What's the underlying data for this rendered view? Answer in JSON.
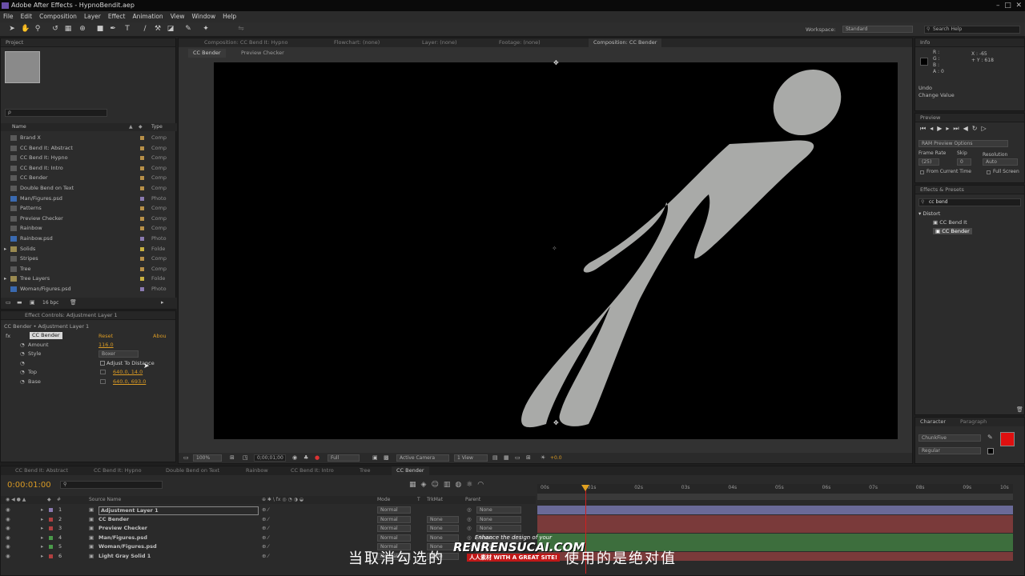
{
  "window": {
    "title": "Adobe After Effects - HypnoBendit.aep"
  },
  "menu": [
    "File",
    "Edit",
    "Composition",
    "Layer",
    "Effect",
    "Animation",
    "View",
    "Window",
    "Help"
  ],
  "toolbar": {
    "workspace_label": "Workspace:",
    "workspace_value": "Standard",
    "search_placeholder": "Search Help"
  },
  "project": {
    "tab": "Project",
    "search_placeholder": "ρ",
    "col_name": "Name",
    "col_type": "Type",
    "items": [
      {
        "name": "Brand X",
        "type": "Comp",
        "color": "#b89048"
      },
      {
        "name": "CC Bend It: Abstract",
        "type": "Comp",
        "color": "#b89048"
      },
      {
        "name": "CC Bend It: Hypno",
        "type": "Comp",
        "color": "#b89048"
      },
      {
        "name": "CC Bend It: Intro",
        "type": "Comp",
        "color": "#b89048"
      },
      {
        "name": "CC Bender",
        "type": "Comp",
        "color": "#b89048"
      },
      {
        "name": "Double Bend on Text",
        "type": "Comp",
        "color": "#b89048"
      },
      {
        "name": "Man/Figures.psd",
        "type": "Photo",
        "color": "#8a7ab0"
      },
      {
        "name": "Patterns",
        "type": "Comp",
        "color": "#b89048"
      },
      {
        "name": "Preview Checker",
        "type": "Comp",
        "color": "#b89048"
      },
      {
        "name": "Rainbow",
        "type": "Comp",
        "color": "#b89048"
      },
      {
        "name": "Rainbow.psd",
        "type": "Photo",
        "color": "#8a7ab0"
      },
      {
        "name": "Solids",
        "type": "Folde",
        "color": "#c8b040"
      },
      {
        "name": "Stripes",
        "type": "Comp",
        "color": "#b89048"
      },
      {
        "name": "Tree",
        "type": "Comp",
        "color": "#b89048"
      },
      {
        "name": "Tree Layers",
        "type": "Folde",
        "color": "#c8b040"
      },
      {
        "name": "Woman/Figures.psd",
        "type": "Photo",
        "color": "#8a7ab0"
      }
    ],
    "bpc": "16 bpc"
  },
  "effect_controls": {
    "tab": "Effect Controls: Adjustment Layer 1",
    "breadcrumb": "CC Bender • Adjustment Layer 1",
    "effect_name": "CC Bender",
    "reset": "Reset",
    "about": "Abou",
    "amount_label": "Amount",
    "amount_value": "116.0",
    "style_label": "Style",
    "style_value": "Boxer",
    "adjust_label": "Adjust To Distance",
    "top_label": "Top",
    "top_value": "640.0, 14.0",
    "base_label": "Base",
    "base_value": "640.0, 693.0"
  },
  "viewer_tabs": {
    "comp_tab_1": "Composition: CC Bend It: Hypno",
    "flowchart": "Flowchart: (none)",
    "layer": "Layer: (none)",
    "footage": "Footage: (none)",
    "comp_tab_active": "Composition: CC Bender",
    "sub_tab_1": "CC Bender",
    "sub_tab_2": "Preview Checker"
  },
  "viewer_footer": {
    "zoom": "100%",
    "timecode": "0;00;01;00",
    "resolution": "Full",
    "camera": "Active Camera",
    "views": "1 View",
    "exposure": "+0.0"
  },
  "info": {
    "tab": "Info",
    "r": "R :",
    "g": "G :",
    "b": "B :",
    "a": "A : 0",
    "x": "X : -65",
    "y": "+ Y : 618",
    "undo": "Undo",
    "change": "Change Value"
  },
  "preview": {
    "tab": "Preview",
    "ram": "RAM Preview Options",
    "frame_rate_label": "Frame Rate",
    "skip_label": "Skip",
    "resolution_label": "Resolution",
    "frame_rate_value": "(25)",
    "skip_value": "0",
    "resolution_value": "Auto",
    "from_current": "From Current Time",
    "full_screen": "Full Screen"
  },
  "effects_presets": {
    "tab": "Effects & Presets",
    "search_value": "cc bend",
    "category": "Distort",
    "items": [
      "CC Bend It",
      "CC Bender"
    ]
  },
  "character": {
    "tab_1": "Character",
    "tab_2": "Paragraph",
    "font": "ChunkFive",
    "style": "Regular",
    "color": "#e01010"
  },
  "timeline": {
    "tabs": [
      "CC Bend It: Abstract",
      "CC Bend It: Hypno",
      "Double Bend on Text",
      "Rainbow",
      "CC Bend It: Intro",
      "Tree",
      "CC Bender"
    ],
    "timecode": "0:00:01:00",
    "col_source": "Source Name",
    "col_mode": "Mode",
    "col_t": "T",
    "col_trkmat": "TrkMat",
    "col_parent": "Parent",
    "ruler": [
      "00s",
      "01s",
      "02s",
      "03s",
      "04s",
      "05s",
      "06s",
      "07s",
      "08s",
      "09s",
      "10s"
    ],
    "layers": [
      {
        "num": "1",
        "name": "Adjustment Layer 1",
        "mode": "Normal",
        "trkmat": "",
        "parent": "None",
        "color": "#8a7ab0",
        "bar": "#6a6a98"
      },
      {
        "num": "2",
        "name": "CC Bender",
        "mode": "Normal",
        "trkmat": "None",
        "parent": "None",
        "color": "#b04040",
        "bar": "#7a3a3a"
      },
      {
        "num": "3",
        "name": "Preview Checker",
        "mode": "Normal",
        "trkmat": "None",
        "parent": "None",
        "color": "#b04040",
        "bar": "#7a3a3a"
      },
      {
        "num": "4",
        "name": "Man/Figures.psd",
        "mode": "Normal",
        "trkmat": "None",
        "parent": "None",
        "color": "#4a9a4a",
        "bar": "#3d6e3d"
      },
      {
        "num": "5",
        "name": "Woman/Figures.psd",
        "mode": "Normal",
        "trkmat": "None",
        "parent": "None",
        "color": "#4a9a4a",
        "bar": "#3d6e3d"
      },
      {
        "num": "6",
        "name": "Light Gray Solid 1",
        "mode": "Normal",
        "trkmat": "None",
        "parent": "None",
        "color": "#b04040",
        "bar": "#7a3a3a"
      }
    ]
  },
  "subtitle": "当取消勾选的",
  "subtitle_tail": "使用的是绝对值",
  "watermark": {
    "top": "Enhance the design of your",
    "main": "RENRENSUCAI.COM",
    "sub": "人人素材 WITH A GREAT SITE!"
  }
}
